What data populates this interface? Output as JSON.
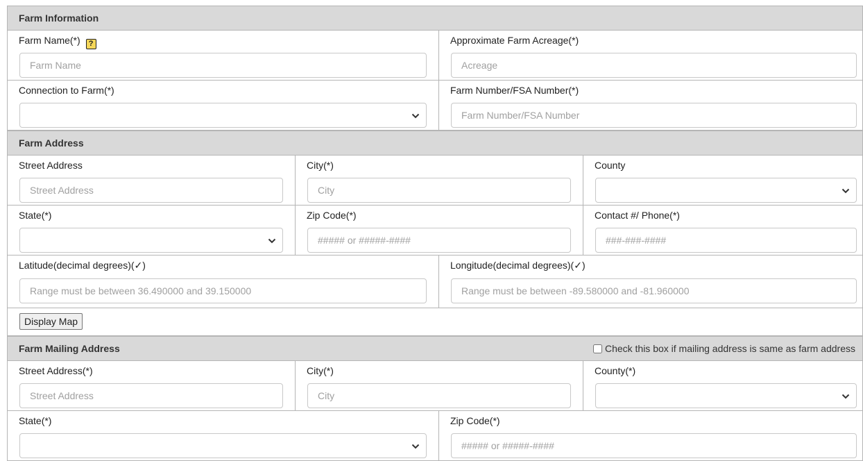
{
  "farm_info": {
    "header": "Farm Information",
    "farm_name_label": "Farm Name(*)",
    "farm_name_placeholder": "Farm Name",
    "help_icon_glyph": "?",
    "acreage_label": "Approximate Farm Acreage(*)",
    "acreage_placeholder": "Acreage",
    "connection_label": "Connection to Farm(*)",
    "connection_value": "",
    "farm_number_label": "Farm Number/FSA Number(*)",
    "farm_number_placeholder": "Farm Number/FSA Number"
  },
  "farm_address": {
    "header": "Farm Address",
    "street_label": "Street Address",
    "street_placeholder": "Street Address",
    "city_label": "City(*)",
    "city_placeholder": "City",
    "county_label": "County",
    "county_value": "",
    "state_label": "State(*)",
    "state_value": "",
    "zip_label": "Zip Code(*)",
    "zip_placeholder": "##### or #####-####",
    "phone_label": "Contact #/ Phone(*)",
    "phone_placeholder": "###-###-####",
    "latitude_label": "Latitude(decimal degrees)(✓)",
    "latitude_placeholder": "Range must be between 36.490000 and 39.150000",
    "longitude_label": "Longitude(decimal degrees)(✓)",
    "longitude_placeholder": "Range must be between -89.580000 and -81.960000",
    "display_map_label": "Display Map"
  },
  "mailing_address": {
    "header": "Farm Mailing Address",
    "same_as_label": "Check this box if mailing address is same as farm address",
    "same_as_checked": false,
    "street_label": "Street Address(*)",
    "street_placeholder": "Street Address",
    "city_label": "City(*)",
    "city_placeholder": "City",
    "county_label": "County(*)",
    "county_value": "",
    "state_label": "State(*)",
    "state_value": "",
    "zip_label": "Zip Code(*)",
    "zip_placeholder": "##### or #####-####"
  },
  "icons": {
    "help": "help-icon",
    "dropdown": "chevron-down-icon"
  },
  "colors": {
    "header_bg": "#d9d9d9",
    "border": "#b5b5b5",
    "help_icon_bg": "#f5d75a"
  }
}
